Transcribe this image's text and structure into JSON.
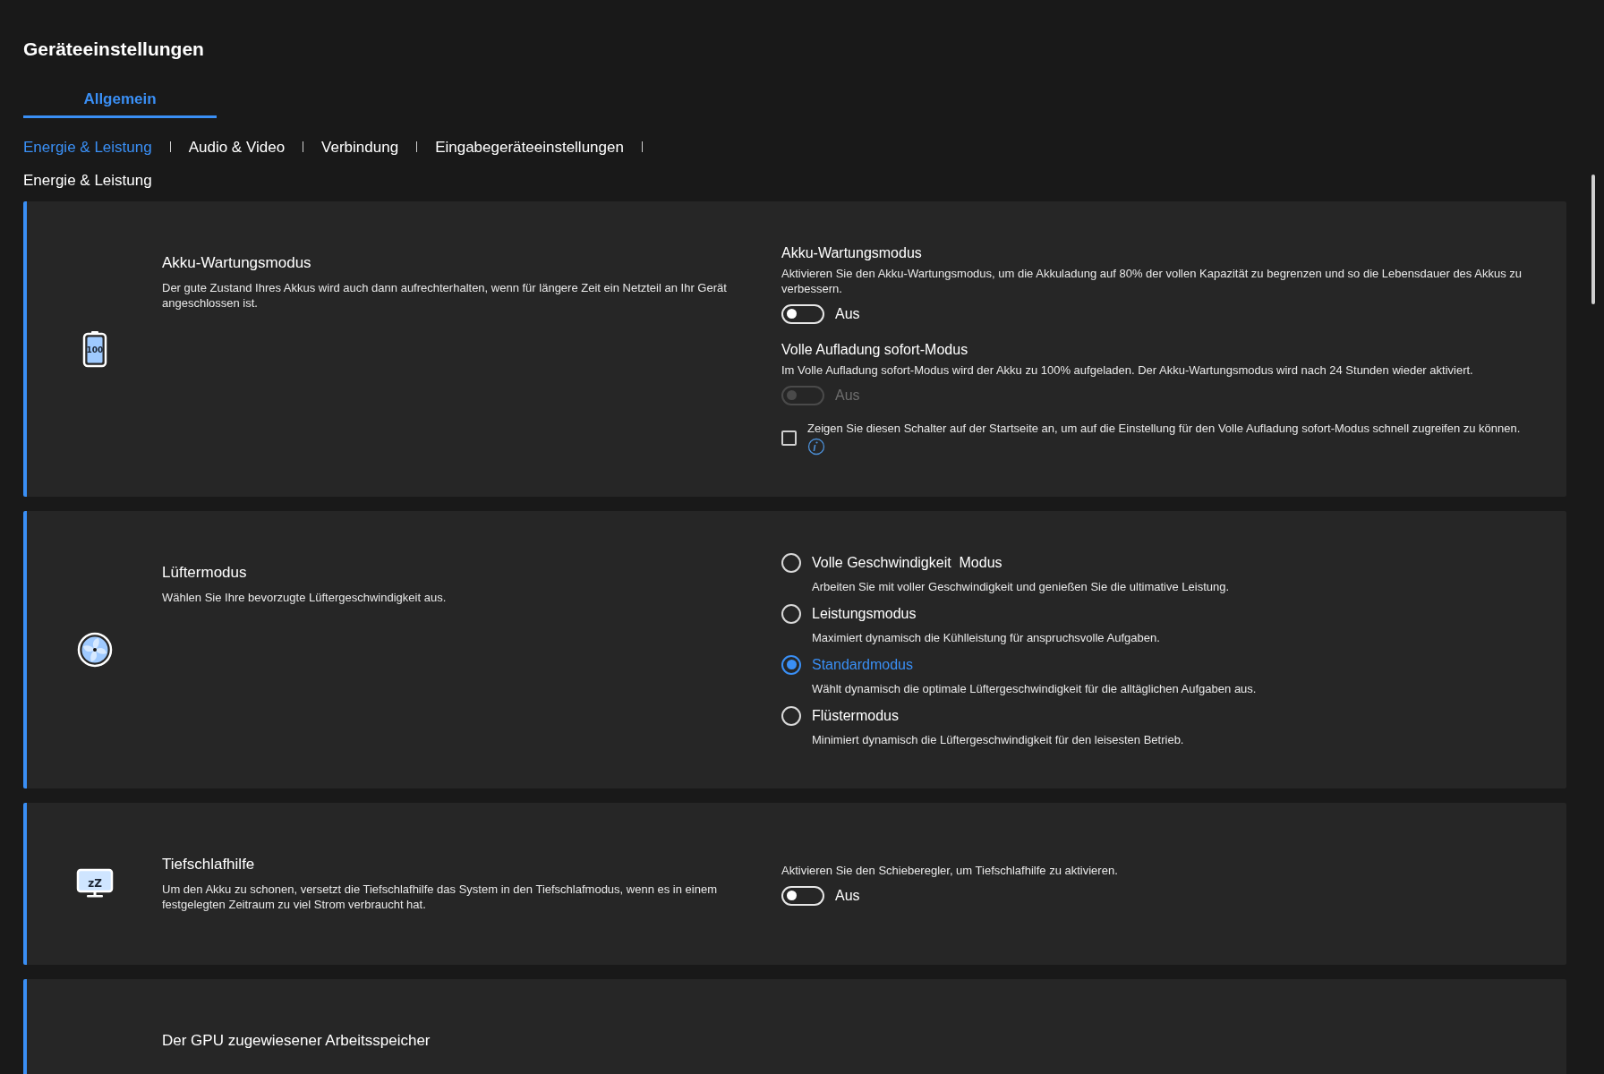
{
  "title": "Geräteeinstellungen",
  "tabs": [
    {
      "label": "Allgemein",
      "selected": true
    }
  ],
  "subnav": [
    {
      "label": "Energie & Leistung",
      "selected": true
    },
    {
      "label": "Audio & Video",
      "selected": false
    },
    {
      "label": "Verbindung",
      "selected": false
    },
    {
      "label": "Eingabegeräteeinstellungen",
      "selected": false
    }
  ],
  "section_heading": "Energie & Leistung",
  "cards": [
    {
      "kind": "battery",
      "icon_text": "100",
      "title": "Akku-Wartungsmodus",
      "description": "Der gute Zustand Ihres Akkus wird auch dann aufrechterhalten, wenn für längere Zeit ein Netzteil an Ihr Gerät angeschlossen ist.",
      "items": [
        {
          "kind": "toggle",
          "title": "Akku-Wartungsmodus",
          "description": "Aktivieren Sie den Akku-Wartungsmodus, um die Akkuladung auf 80% der vollen Kapazität zu begrenzen und so die Lebensdauer des Akkus zu verbessern.",
          "state_label": "Aus",
          "on": false,
          "disabled": false
        },
        {
          "kind": "toggle",
          "title": "Volle Aufladung sofort-Modus",
          "description": "Im Volle Aufladung sofort-Modus wird der Akku zu 100% aufgeladen. Der Akku-Wartungsmodus wird nach 24 Stunden wieder aktiviert.",
          "state_label": "Aus",
          "on": false,
          "disabled": true
        },
        {
          "kind": "checkbox",
          "label": "Zeigen Sie diesen Schalter auf der Startseite an, um auf die Einstellung für den Volle Aufladung sofort-Modus schnell zugreifen zu können.",
          "checked": false,
          "info": true
        }
      ]
    },
    {
      "kind": "fan",
      "title": "Lüftermodus",
      "description": "Wählen Sie Ihre bevorzugte Lüftergeschwindigkeit aus.",
      "items": [
        {
          "kind": "radio",
          "label": "Volle Geschwindigkeit  Modus",
          "description": "Arbeiten Sie mit voller Geschwindigkeit und genießen Sie die ultimative Leistung.",
          "selected": false
        },
        {
          "kind": "radio",
          "label": "Leistungsmodus",
          "description": "Maximiert dynamisch die Kühlleistung für anspruchsvolle Aufgaben.",
          "selected": false
        },
        {
          "kind": "radio",
          "label": "Standardmodus",
          "description": "Wählt dynamisch die optimale Lüftergeschwindigkeit für die alltäglichen Aufgaben aus.",
          "selected": true
        },
        {
          "kind": "radio",
          "label": "Flüstermodus",
          "description": "Minimiert dynamisch die Lüftergeschwindigkeit für den leisesten Betrieb.",
          "selected": false
        }
      ]
    },
    {
      "kind": "sleep",
      "icon_text": "zZ",
      "title": "Tiefschlafhilfe",
      "description": "Um den Akku zu schonen, versetzt die Tiefschlafhilfe das System in den Tiefschlafmodus, wenn es in einem festgelegten Zeitraum zu viel Strom verbraucht hat.",
      "items": [
        {
          "kind": "toggle",
          "description": "Aktivieren Sie den Schieberegler, um Tiefschlafhilfe zu aktivieren.",
          "state_label": "Aus",
          "on": false,
          "disabled": false
        }
      ]
    },
    {
      "title": "Der GPU zugewiesener Arbeitsspeicher"
    }
  ]
}
